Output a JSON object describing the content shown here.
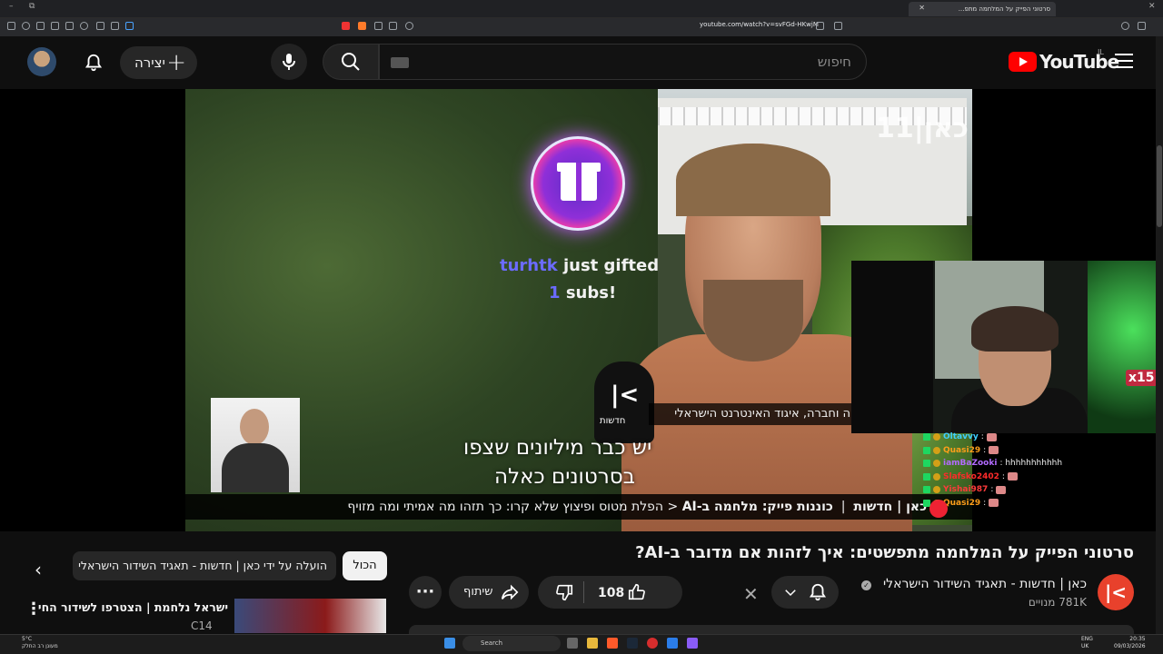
{
  "browser": {
    "tab_title": "סרטוני הפייק על המלחמה מתפ...",
    "url": "youtube.com/watch?v=svFGd-HKwjM"
  },
  "header": {
    "create_label": "יצירה",
    "search_placeholder": "חיפוש",
    "logo_text": "YouTube",
    "logo_country": "IL"
  },
  "video": {
    "channel_bug": "כאן|11",
    "gift_user": "turhtk",
    "gift_text": "just gifted",
    "gift_count": "1",
    "gift_subs": "subs!",
    "lower_third": "ה וחברה, איגוד האינטרנט הישראלי",
    "mic_logo": "חדשות",
    "subtitle_line1": "יש כבר מיליונים שצפו",
    "subtitle_line2": "בסרטונים כאלה",
    "ticker_source": "כאן | חדשות",
    "ticker_section": "כוננות פייק: מלחמה ב-AI",
    "ticker_headline": "הפלת מטוס ופיצוץ שלא קרו: כך תזהו מה אמיתי ומה מזויף"
  },
  "stream": {
    "cam_emote": "x15",
    "chat": [
      {
        "name": "Oltavvy",
        "color": "#3fd0ff",
        "text": ":"
      },
      {
        "name": "Quasi29",
        "color": "#ff9f1a",
        "text": ":"
      },
      {
        "name": "iamBaZooki",
        "color": "#b26bff",
        "text": ": hhhhhhhhhhh"
      },
      {
        "name": "Slafsko2402",
        "color": "#ff2a2a",
        "text": ":"
      },
      {
        "name": "Yishai987",
        "color": "#ff3b3b",
        "text": ":"
      },
      {
        "name": "Quasi29",
        "color": "#ff9f1a",
        "text": ":"
      }
    ]
  },
  "meta": {
    "title": "סרטוני הפייק על המלחמה מתפשטים: איך לזהות אם מדובר ב-AI?",
    "channel_name": "כאן | חדשות - תאגיד השידור הישראלי",
    "subscribers": "781K מנויים",
    "likes": "108",
    "share_label": "שיתוף"
  },
  "chips": {
    "all_label": "הכול",
    "uploaded_label": "הועלה על ידי כאן | חדשות - תאגיד השידור הישראלי"
  },
  "recommendation": {
    "title": "ישראל נלחמת | הצטרפו לשידור החי",
    "channel": "C14"
  },
  "taskbar": {
    "search_label": "Search",
    "weather": "5°C",
    "weather_sub": "מעונן רב החלק",
    "lang": "ENG",
    "lang_sub": "UK",
    "time": "20:35",
    "date": "09/03/2026"
  },
  "colors": {
    "yt_red": "#ff0000",
    "background": "#0f0f0f",
    "pill": "#272727"
  }
}
